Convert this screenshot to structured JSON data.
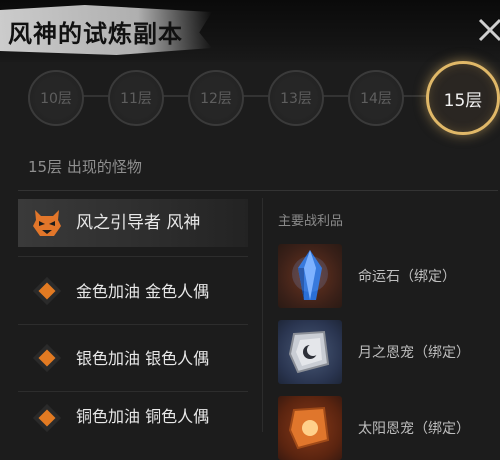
{
  "header": {
    "title": "风神的试炼副本"
  },
  "floors": [
    {
      "label": "10层",
      "active": false
    },
    {
      "label": "11层",
      "active": false
    },
    {
      "label": "12层",
      "active": false
    },
    {
      "label": "13层",
      "active": false
    },
    {
      "label": "14层",
      "active": false
    },
    {
      "label": "15层",
      "active": true
    }
  ],
  "monsters_heading": "15层 出现的怪物",
  "monsters": [
    {
      "name": "风之引导者 风神",
      "icon": "demon-head-icon",
      "selected": true
    },
    {
      "name": "金色加油 金色人偶",
      "icon": "orange-diamond-icon",
      "selected": false
    },
    {
      "name": "银色加油 银色人偶",
      "icon": "orange-diamond-icon",
      "selected": false
    },
    {
      "name": "铜色加油 铜色人偶",
      "icon": "orange-diamond-icon",
      "selected": false
    }
  ],
  "loot_heading": "主要战利品",
  "loot": [
    {
      "name": "命运石（绑定）",
      "icon": "blue-crystal-icon"
    },
    {
      "name": "月之恩宠（绑定）",
      "icon": "moon-rune-icon"
    },
    {
      "name": "太阳恩宠（绑定）",
      "icon": "sun-rune-icon"
    }
  ],
  "colors": {
    "accent": "#e0b868",
    "marker": "#e27a22",
    "background": "#1c1c1c"
  }
}
